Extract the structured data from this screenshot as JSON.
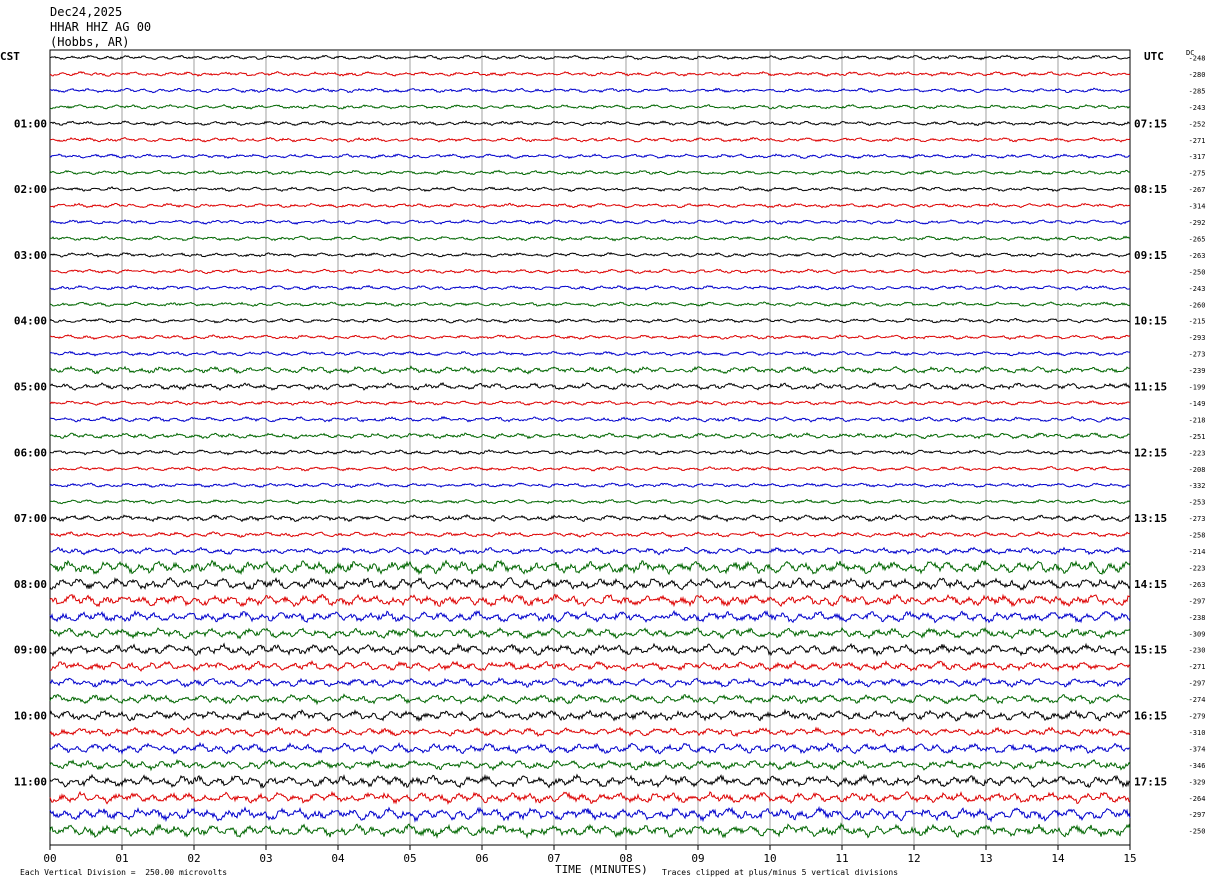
{
  "header": {
    "date": "Dec24,2025",
    "station": "HHAR HHZ AG 00",
    "location": "(Hobbs, AR)"
  },
  "left_timezone": "CST",
  "right_timezone": "UTC",
  "dc_label": "DC",
  "footer": {
    "vertical_division": "Each Vertical Division =  250.00 microvolts",
    "xlabel": "TIME (MINUTES)",
    "clip_note": "Traces clipped at plus/minus 5 vertical divisions"
  },
  "colors": {
    "cycle": [
      "#000000",
      "#dd0000",
      "#0000cc",
      "#006600"
    ],
    "grid": "#888888"
  },
  "chart_data": {
    "type": "line",
    "title": "HHAR HHZ AG 00",
    "xlabel": "TIME (MINUTES)",
    "x_range": [
      0,
      15
    ],
    "x_ticks": [
      "00",
      "01",
      "02",
      "03",
      "04",
      "05",
      "06",
      "07",
      "08",
      "09",
      "10",
      "11",
      "12",
      "13",
      "14",
      "15"
    ],
    "trace_minutes": 15,
    "trace_count": 48,
    "left_hour_labels": [
      "01:00",
      "02:00",
      "03:00",
      "04:00",
      "05:00",
      "06:00",
      "07:00",
      "08:00",
      "09:00",
      "10:00",
      "11:00"
    ],
    "right_hour_labels": [
      "07:15",
      "08:15",
      "09:15",
      "10:15",
      "11:15",
      "12:15",
      "13:15",
      "14:15",
      "15:15",
      "16:15",
      "17:15"
    ],
    "dc_offsets": [
      -248,
      -280,
      -285,
      -243,
      -252,
      -271,
      -317,
      -275,
      -267,
      -314,
      -292,
      -265,
      -263,
      -250,
      -243,
      -260,
      -215,
      -293,
      -273,
      -239,
      -199,
      -149,
      -218,
      -251,
      -223,
      -208,
      -332,
      -253,
      -273,
      -258,
      -214,
      -223,
      -263,
      -297,
      -238,
      -309,
      -230,
      -271,
      -297,
      -274,
      -279,
      -310,
      -374,
      -346,
      -329,
      -264,
      -297,
      -250
    ],
    "trace_amplitudes": [
      1,
      1,
      1,
      1,
      1,
      1,
      1,
      1,
      1,
      1,
      1,
      1,
      1,
      1,
      1,
      1,
      1,
      1,
      1,
      1.6,
      1.6,
      1,
      1.2,
      1.3,
      1.1,
      1,
      1,
      1,
      1.5,
      1.2,
      1.6,
      3.2,
      2.8,
      2.8,
      2.6,
      2.4,
      2.6,
      2.2,
      2,
      2.2,
      2.4,
      2,
      2.4,
      2.2,
      2.8,
      2.6,
      3,
      3
    ],
    "grid": true
  }
}
